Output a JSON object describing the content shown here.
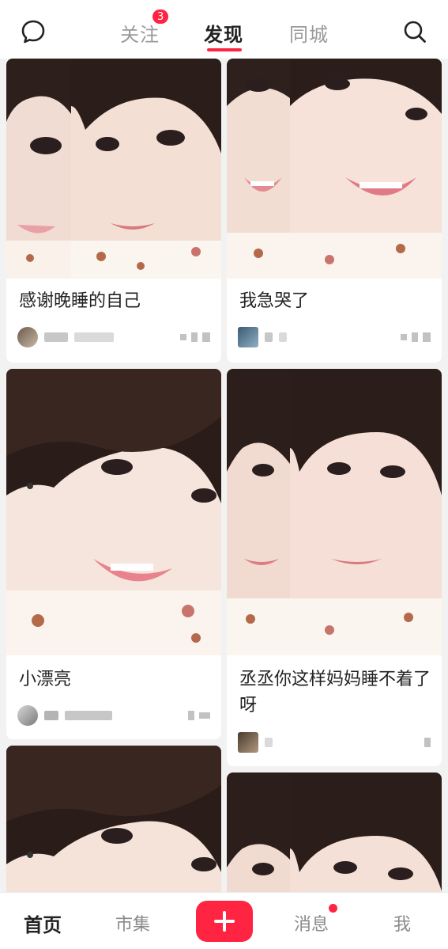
{
  "top_nav": {
    "tabs": [
      {
        "label": "关注",
        "badge": "3"
      },
      {
        "label": "发现"
      },
      {
        "label": "同城"
      }
    ],
    "active_tab": "发现",
    "left_icon": "chat-bubble-icon",
    "right_icon": "search-icon"
  },
  "feed": {
    "cards": [
      {
        "title": "感谢晚睡的自己"
      },
      {
        "title": "我急哭了"
      },
      {
        "title": "小漂亮"
      },
      {
        "title": "丞丞你这样妈妈睡不着了呀"
      }
    ]
  },
  "bottom_nav": {
    "items": [
      "首页",
      "市集",
      "消息",
      "我"
    ],
    "active": "首页",
    "add_icon": "plus-icon"
  },
  "colors": {
    "accent": "#ff2442",
    "background": "#f2f2f2"
  }
}
